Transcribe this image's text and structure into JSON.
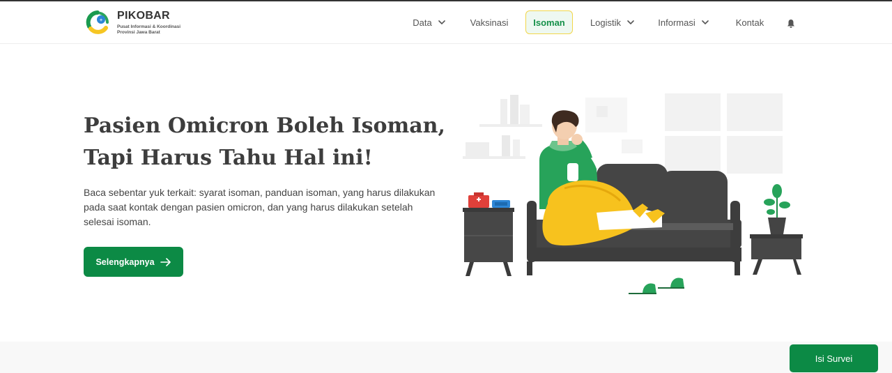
{
  "brand": {
    "name": "PIKOBAR",
    "subtitle_line1": "Pusat Informasi & Koordinasi",
    "subtitle_line2": "Provinsi Jawa Barat",
    "logo_icon": "pikobar-logo-icon"
  },
  "nav": {
    "items": [
      {
        "label": "Data",
        "has_dropdown": true
      },
      {
        "label": "Vaksinasi",
        "has_dropdown": false
      },
      {
        "label": "Isoman",
        "has_dropdown": false,
        "active": true
      },
      {
        "label": "Logistik",
        "has_dropdown": true
      },
      {
        "label": "Informasi",
        "has_dropdown": true
      },
      {
        "label": "Kontak",
        "has_dropdown": false
      }
    ],
    "notification_icon": "bell-icon"
  },
  "hero": {
    "title_line1": "Pasien Omicron Boleh Isoman,",
    "title_line2": "Tapi Harus Tahu Hal ini!",
    "description": "Baca sebentar yuk terkait: syarat isoman, panduan isoman, yang harus dilakukan pada saat kontak dengan pasien omicron, dan yang harus dilakukan setelah selesai isoman.",
    "cta_label": "Selengkapnya",
    "cta_icon": "arrow-right-icon"
  },
  "survey_button": "Isi Survei",
  "colors": {
    "primary_green": "#0c8a45",
    "active_border": "#f2d649",
    "active_bg": "#eef8f1",
    "title_text": "#3d3d3d",
    "blanket_yellow": "#f7c21e",
    "sofa_dark": "#454545"
  }
}
